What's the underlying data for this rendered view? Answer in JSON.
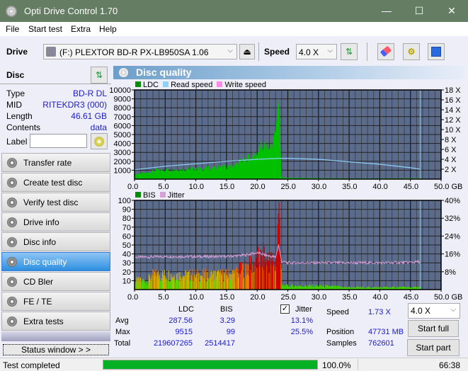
{
  "window": {
    "title": "Opti Drive Control 1.70",
    "minimize": "—",
    "maximize": "☐",
    "close": "✕"
  },
  "menu": [
    "File",
    "Start test",
    "Extra",
    "Help"
  ],
  "toolbar": {
    "drive_label": "Drive",
    "drive_value": "(F:)  PLEXTOR BD-R  PX-LB950SA 1.06",
    "speed_label": "Speed",
    "speed_value": "4.0 X"
  },
  "disc": {
    "title": "Disc",
    "type_label": "Type",
    "type": "BD-R DL",
    "mid_label": "MID",
    "mid": "RITEKDR3 (000)",
    "length_label": "Length",
    "length": "46.61 GB",
    "contents_label": "Contents",
    "contents": "data",
    "label_label": "Label",
    "label_value": ""
  },
  "nav": [
    "Transfer rate",
    "Create test disc",
    "Verify test disc",
    "Drive info",
    "Disc info",
    "Disc quality",
    "CD Bler",
    "FE / TE",
    "Extra tests"
  ],
  "nav_active": 5,
  "status_window": "Status window > >",
  "panel_title": "Disc quality",
  "chart_data": [
    {
      "type": "area",
      "title": "LDC / Read speed",
      "legend": [
        "LDC",
        "Read speed",
        "Write speed"
      ],
      "legend_colors": [
        "#0a8a0a",
        "#8fd0f8",
        "#ff88e8"
      ],
      "xlabel": "GB",
      "xlim": [
        0,
        50
      ],
      "x_ticks": [
        "0.0",
        "5.0",
        "10.0",
        "15.0",
        "20.0",
        "25.0",
        "30.0",
        "35.0",
        "40.0",
        "45.0",
        "50.0 GB"
      ],
      "ylim": [
        0,
        10000
      ],
      "y_ticks": [
        "1000",
        "2000",
        "3000",
        "4000",
        "5000",
        "6000",
        "7000",
        "8000",
        "9000",
        "10000"
      ],
      "y2lim": [
        0,
        18
      ],
      "y2_ticks": [
        "2 X",
        "4 X",
        "6 X",
        "8 X",
        "10 X",
        "12 X",
        "14 X",
        "16 X",
        "18 X"
      ],
      "ldc_x": [
        0,
        1,
        2,
        3,
        4,
        5,
        6,
        7,
        8,
        9,
        10,
        11,
        12,
        13,
        14,
        15,
        16,
        17,
        18,
        19,
        20,
        21,
        22,
        23,
        23.5,
        24,
        25,
        30,
        35,
        40,
        45,
        46.6
      ],
      "ldc_y": [
        600,
        600,
        700,
        950,
        1000,
        1050,
        1050,
        1100,
        1100,
        1150,
        1150,
        1200,
        1250,
        1300,
        1350,
        1400,
        1450,
        1900,
        2200,
        2600,
        3000,
        3700,
        3400,
        5000,
        9500,
        200,
        150,
        100,
        80,
        80,
        100,
        100
      ],
      "read_speed_x": [
        0,
        5,
        10,
        15,
        20,
        23.6,
        25,
        30,
        35,
        40,
        45,
        46.6
      ],
      "read_speed_y": [
        1.9,
        2.6,
        3.1,
        3.6,
        4.0,
        4.2,
        4.2,
        4.0,
        3.5,
        3.0,
        2.3,
        2.0
      ],
      "end_marker": 46.6
    },
    {
      "type": "bar",
      "title": "BIS / Jitter",
      "legend": [
        "BIS",
        "Jitter"
      ],
      "legend_colors": [
        "#0a8a0a",
        "#d8a0d8"
      ],
      "xlim": [
        0,
        50
      ],
      "x_ticks": [
        "0.0",
        "5.0",
        "10.0",
        "15.0",
        "20.0",
        "25.0",
        "30.0",
        "35.0",
        "40.0",
        "45.0",
        "50.0 GB"
      ],
      "ylim": [
        0,
        100
      ],
      "y_ticks": [
        "10",
        "20",
        "30",
        "40",
        "50",
        "60",
        "70",
        "80",
        "90",
        "100"
      ],
      "y2lim": [
        0,
        40
      ],
      "y2_ticks": [
        "8%",
        "16%",
        "24%",
        "32%",
        "40%"
      ],
      "bis_x": [
        0,
        2,
        3,
        5,
        8,
        10,
        13,
        15,
        17,
        19,
        20,
        21,
        22,
        23,
        23.5,
        24,
        25,
        30,
        35,
        40,
        45,
        46.6
      ],
      "bis_y": [
        12,
        12,
        20,
        20,
        20,
        20,
        20,
        20,
        25,
        35,
        40,
        45,
        40,
        35,
        98,
        5,
        5,
        5,
        3,
        3,
        3,
        3
      ],
      "jitter_x": [
        0,
        5,
        10,
        15,
        18,
        20,
        22,
        23,
        23.5,
        24,
        25,
        30,
        35,
        40,
        45,
        46.6
      ],
      "jitter_y": [
        14.5,
        14.8,
        14.8,
        14.8,
        15.5,
        16.5,
        15,
        14.5,
        20,
        12.5,
        12,
        12,
        12,
        12,
        12.2,
        12.5
      ]
    }
  ],
  "stats": {
    "col_ldc": "LDC",
    "col_bis": "BIS",
    "jitter_label": "Jitter",
    "jitter_checked": true,
    "avg_label": "Avg",
    "avg_ldc": "287.56",
    "avg_bis": "3.29",
    "avg_jitter": "13.1%",
    "max_label": "Max",
    "max_ldc": "9515",
    "max_bis": "99",
    "max_jitter": "25.5%",
    "total_label": "Total",
    "total_ldc": "219607265",
    "total_bis": "2514417",
    "speed_label": "Speed",
    "speed": "1.73 X",
    "position_label": "Position",
    "position": "47731 MB",
    "samples_label": "Samples",
    "samples": "762601",
    "speed_select": "4.0 X",
    "start_full": "Start full",
    "start_part": "Start part"
  },
  "status": {
    "text": "Test completed",
    "progress_pct": 100,
    "progress_label": "100.0%",
    "time": "66:38"
  }
}
